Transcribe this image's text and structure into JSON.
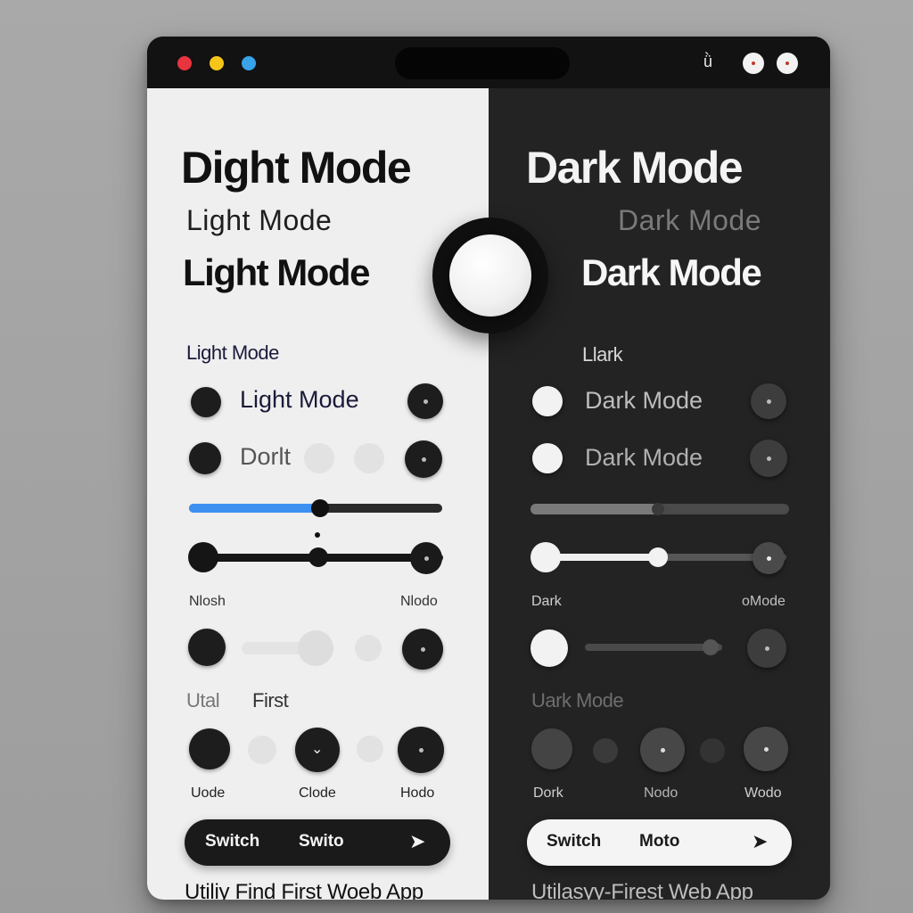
{
  "window": {
    "controls": {
      "colors": [
        "#e8343f",
        "#f5c518",
        "#38a3e8"
      ]
    },
    "toolbar_glyph": "ǜ"
  },
  "light": {
    "title": "Dight Mode",
    "subtitle": "Light  Mode",
    "title2": "Light Mode",
    "section_label": "Light Mode",
    "row1_label": "Light Mode",
    "row2_label": "Dorlt",
    "slider_left_label": "Nlosh",
    "slider_right_label": "Nlodo",
    "caption_a": "Utal",
    "caption_b": "First",
    "btn_label_1": "Uode",
    "btn_label_2": "Clode",
    "btn_label_3": "Hodo",
    "switch_text_1": "Switch",
    "switch_text_2": "Swito",
    "switch_arrow": "➤",
    "footer": "Utiliy Find First Woeb App",
    "accent_color": "#3d8ff0",
    "slider_progress": 0.55
  },
  "dark": {
    "title": "Dark Mode",
    "subtitle": "Dark   Mode",
    "title2": "Dark Mode",
    "section_label": "Llark",
    "row1_label": "Dark Mode",
    "row2_label": "Dark Mode",
    "slider_left_label": "Dark",
    "slider_right_label": "oMode",
    "caption": "Uark Mode",
    "btn_label_1": "Dork",
    "btn_label_2": "Nodo",
    "btn_label_3": "Wodo",
    "switch_text_1": "Switch",
    "switch_text_2": "Moto",
    "switch_arrow": "➤",
    "footer": "Utilasyy-Firest  Web App",
    "slider_progress": 0.55
  }
}
